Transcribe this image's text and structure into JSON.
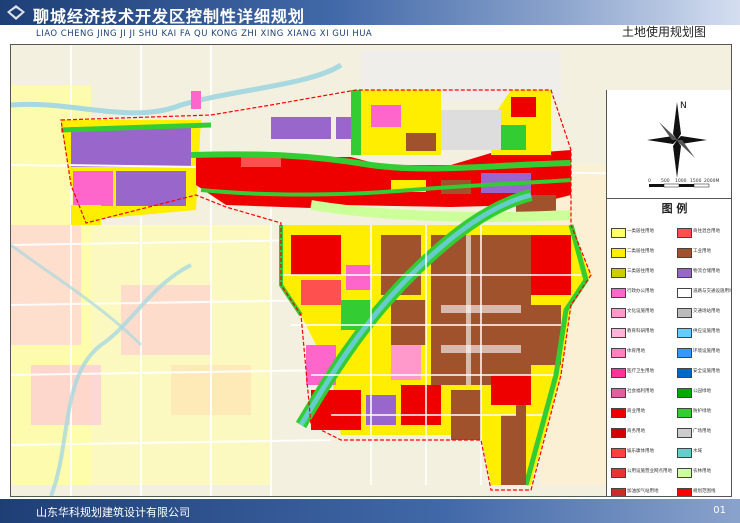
{
  "header": {
    "title": "聊城经济技术开发区控制性详细规划",
    "pinyin": "LIAO CHENG JING JI JI SHU KAI FA QU KONG ZHI XING XIANG XI GUI HUA",
    "map_name": "土地使用规划图"
  },
  "compass": {
    "north_label": "N",
    "scale_labels": [
      "0",
      "500",
      "1000",
      "1500",
      "2000M"
    ]
  },
  "legend": {
    "title": "图 例",
    "items": [
      {
        "label": "一类居住用地",
        "color": "#ffff66"
      },
      {
        "label": "二类居住用地",
        "color": "#ffee00"
      },
      {
        "label": "三类居住用地",
        "color": "#cccc00"
      },
      {
        "label": "行政办公用地",
        "color": "#ff66cc"
      },
      {
        "label": "文化设施用地",
        "color": "#ff99cc"
      },
      {
        "label": "教育科研用地",
        "color": "#ffb3d9"
      },
      {
        "label": "体育用地",
        "color": "#ff80bf"
      },
      {
        "label": "医疗卫生用地",
        "color": "#ff3399"
      },
      {
        "label": "社会福利用地",
        "color": "#e05fa0"
      },
      {
        "label": "商业用地",
        "color": "#ee0000"
      },
      {
        "label": "商务用地",
        "color": "#d40000"
      },
      {
        "label": "娱乐康体用地",
        "color": "#ff4040"
      },
      {
        "label": "公用设施营业网点用地",
        "color": "#e63333"
      },
      {
        "label": "加油加气站用地",
        "color": "#cc2929"
      },
      {
        "label": "商住混合用地",
        "color": "#ff5050"
      },
      {
        "label": "工业用地",
        "color": "#a0522d"
      },
      {
        "label": "物流仓储用地",
        "color": "#9966cc"
      },
      {
        "label": "道路与交通设施用地",
        "color": "#ffffff"
      },
      {
        "label": "交通场站用地",
        "color": "#bbbbbb"
      },
      {
        "label": "供应设施用地",
        "color": "#66ccff"
      },
      {
        "label": "环境设施用地",
        "color": "#3399ff"
      },
      {
        "label": "安全设施用地",
        "color": "#0066cc"
      },
      {
        "label": "公园绿地",
        "color": "#00aa00"
      },
      {
        "label": "防护绿地",
        "color": "#33cc33"
      },
      {
        "label": "广场用地",
        "color": "#cccccc"
      },
      {
        "label": "水域",
        "color": "#66cccc"
      },
      {
        "label": "农林用地",
        "color": "#ccff99"
      },
      {
        "label": "规划范围线",
        "color": "#ff0000"
      }
    ]
  },
  "footer": {
    "company": "山东华科规划建筑设计有限公司",
    "page": "01"
  },
  "colors": {
    "header_band": "#1e3f76",
    "residential": "#ffee00",
    "commercial": "#ee0000",
    "industrial": "#a0522d",
    "logistics": "#9966cc",
    "green": "#33cc33",
    "water": "#66cccc",
    "planning_boundary": "#ff0000"
  }
}
